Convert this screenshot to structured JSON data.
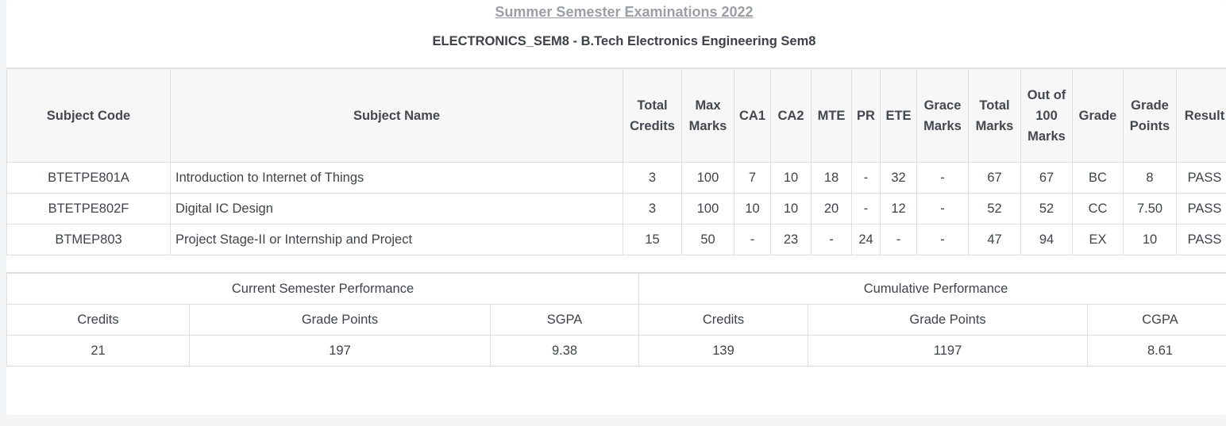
{
  "exam_title": "Summer Semester Examinations 2022",
  "program_title": "ELECTRONICS_SEM8 - B.Tech Electronics Engineering Sem8",
  "marks_table": {
    "headers": {
      "subject_code": "Subject Code",
      "subject_name": "Subject Name",
      "total_credits": "Total Credits",
      "max_marks": "Max Marks",
      "ca1": "CA1",
      "ca2": "CA2",
      "mte": "MTE",
      "pr": "PR",
      "ete": "ETE",
      "grace_marks": "Grace Marks",
      "total_marks": "Total Marks",
      "out_of_100": "Out of 100 Marks",
      "grade": "Grade",
      "grade_points": "Grade Points",
      "result": "Result"
    },
    "rows": [
      {
        "subject_code": "BTETPE801A",
        "subject_name": "Introduction to Internet of Things",
        "total_credits": "3",
        "max_marks": "100",
        "ca1": "7",
        "ca2": "10",
        "mte": "18",
        "pr": "-",
        "ete": "32",
        "grace_marks": "-",
        "total_marks": "67",
        "out_of_100": "67",
        "grade": "BC",
        "grade_points": "8",
        "result": "PASS"
      },
      {
        "subject_code": "BTETPE802F",
        "subject_name": "Digital IC Design",
        "total_credits": "3",
        "max_marks": "100",
        "ca1": "10",
        "ca2": "10",
        "mte": "20",
        "pr": "-",
        "ete": "12",
        "grace_marks": "-",
        "total_marks": "52",
        "out_of_100": "52",
        "grade": "CC",
        "grade_points": "7.50",
        "result": "PASS"
      },
      {
        "subject_code": "BTMEP803",
        "subject_name": "Project Stage-II or Internship and Project",
        "total_credits": "15",
        "max_marks": "50",
        "ca1": "-",
        "ca2": "23",
        "mte": "-",
        "pr": "24",
        "ete": "-",
        "grace_marks": "-",
        "total_marks": "47",
        "out_of_100": "94",
        "grade": "EX",
        "grade_points": "10",
        "result": "PASS"
      }
    ]
  },
  "performance": {
    "current": {
      "title": "Current Semester Performance",
      "credits_label": "Credits",
      "grade_points_label": "Grade Points",
      "sgpa_label": "SGPA",
      "credits": "21",
      "grade_points": "197",
      "sgpa": "9.38"
    },
    "cumulative": {
      "title": "Cumulative Performance",
      "credits_label": "Credits",
      "grade_points_label": "Grade Points",
      "cgpa_label": "CGPA",
      "credits": "139",
      "grade_points": "1197",
      "cgpa": "8.61"
    }
  },
  "colors": {
    "page_background": "#f4f5f7",
    "card_background": "#ffffff",
    "header_background": "#f7f7f8",
    "border": "#dcdee2",
    "exam_title": "#9a9fa5",
    "text": "#3f444a"
  }
}
